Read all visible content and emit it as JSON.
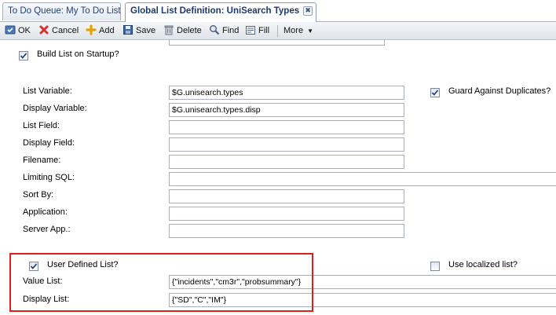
{
  "tabs": [
    {
      "label": "To Do Queue: My To Do List",
      "active": false
    },
    {
      "label": "Global List Definition: UniSearch Types",
      "active": true,
      "close": "✖"
    }
  ],
  "toolbar": {
    "ok": "OK",
    "cancel": "Cancel",
    "add": "Add",
    "save": "Save",
    "delete": "Delete",
    "find": "Find",
    "fill": "Fill",
    "more": "More"
  },
  "form": {
    "build_on_startup": {
      "label": "Build List on Startup?",
      "checked": true
    },
    "list_variable": {
      "label": "List Variable:",
      "value": "$G.unisearch.types"
    },
    "display_variable": {
      "label": "Display Variable:",
      "value": "$G.unisearch.types.disp"
    },
    "list_field": {
      "label": "List Field:",
      "value": ""
    },
    "display_field": {
      "label": "Display Field:",
      "value": ""
    },
    "filename": {
      "label": "Filename:",
      "value": ""
    },
    "limiting_sql": {
      "label": "Limiting SQL:",
      "value": ""
    },
    "sort_by": {
      "label": "Sort By:",
      "value": ""
    },
    "application": {
      "label": "Application:",
      "value": ""
    },
    "server_app": {
      "label": "Server App.:",
      "value": ""
    },
    "guard_duplicates": {
      "label": "Guard Against Duplicates?",
      "checked": true
    },
    "user_defined_list": {
      "label": "User Defined List?",
      "checked": true
    },
    "use_localized_list": {
      "label": "Use localized list?",
      "checked": false
    },
    "value_list": {
      "label": "Value List:",
      "value": "{\"incidents\",\"cm3r\",\"probsummary\"}"
    },
    "display_list": {
      "label": "Display List:",
      "value": "{\"SD\",\"C\",\"IM\"}"
    }
  },
  "colors": {
    "highlight_box": "#e01e1e",
    "tab_text": "#1c3a6e"
  }
}
